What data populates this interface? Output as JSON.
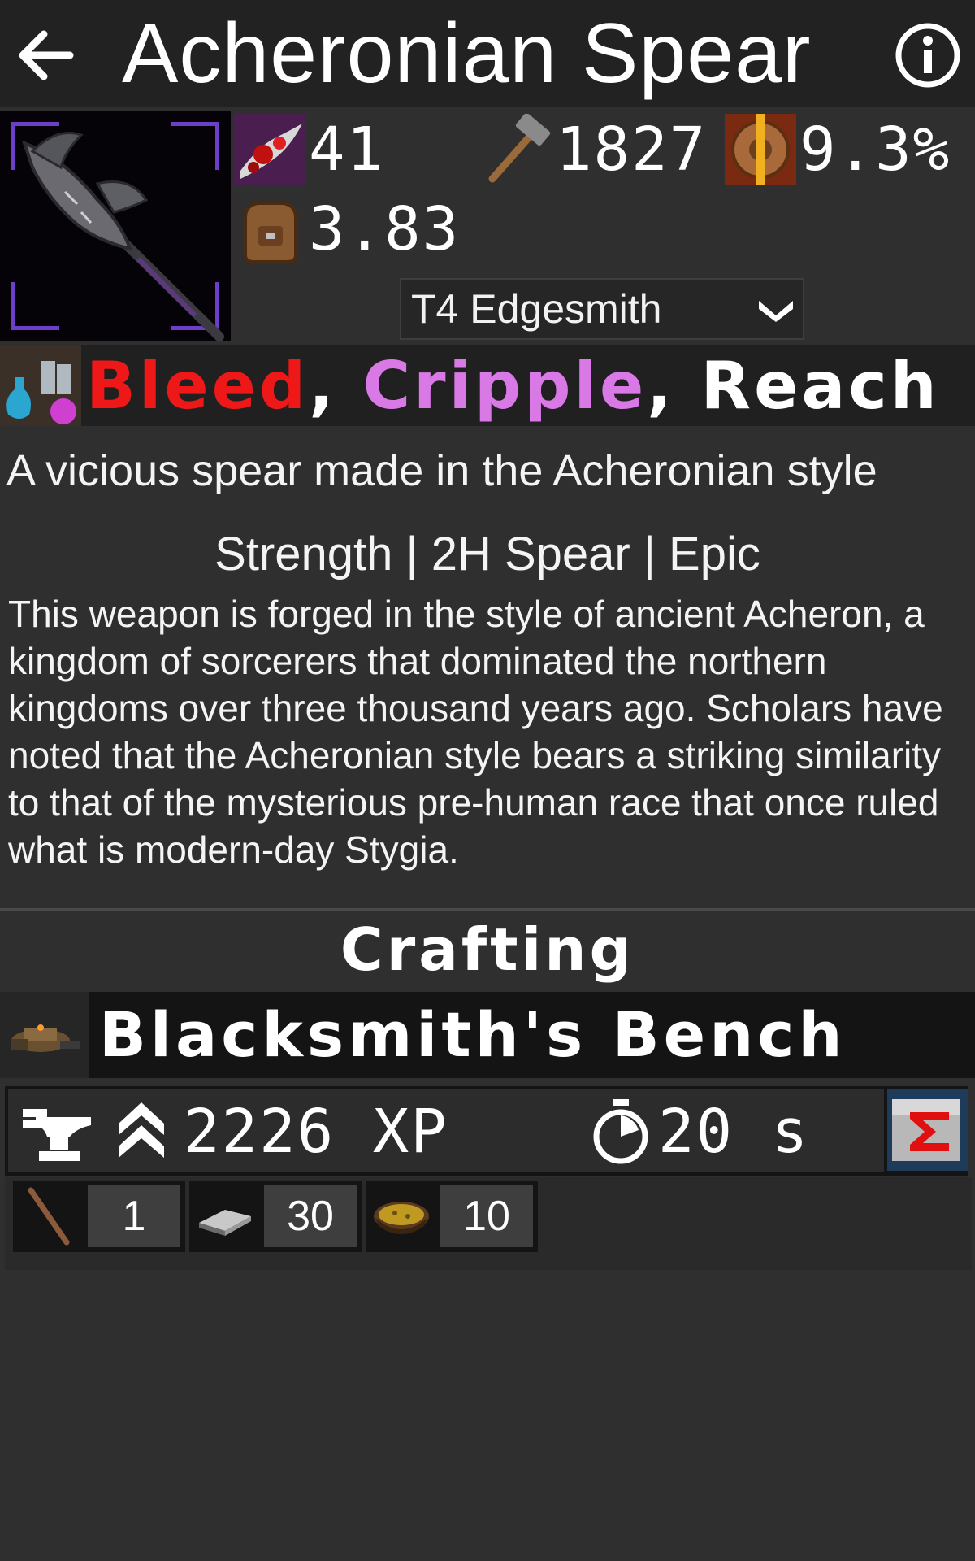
{
  "header": {
    "title": "Acheronian Spear"
  },
  "stats": {
    "damage": "41",
    "durability": "1827",
    "armor_pen": "9.3%",
    "weight": "3.83"
  },
  "crafter": {
    "selected": "T4 Edgesmith"
  },
  "perks": {
    "bleed": "Bleed",
    "cripple": "Cripple",
    "reach": "Reach",
    "sep1": ", ",
    "sep2": ", "
  },
  "description": {
    "short": "A vicious spear made in the Acheronian style",
    "meta": "Strength | 2H Spear | Epic",
    "lore": "This weapon is forged in the style of ancient Acheron, a kingdom of sorcerers that dominated the northern kingdoms over three thousand years ago. Scholars have noted that the Acheronian style bears a striking similarity to that of the mysterious pre-human race that once ruled what is modern-day Stygia."
  },
  "crafting": {
    "section_title": "Crafting",
    "station": "Blacksmith's Bench",
    "xp": "2226 XP",
    "time": "20 s",
    "materials": [
      {
        "icon": "shaft-icon",
        "qty": "1"
      },
      {
        "icon": "ingot-icon",
        "qty": "30"
      },
      {
        "icon": "tar-bowl-icon",
        "qty": "10"
      }
    ]
  },
  "colors": {
    "bleed": "#ef1818",
    "cripple": "#d979e6",
    "header_bg": "#222222",
    "page_bg": "#2f2f2f"
  }
}
